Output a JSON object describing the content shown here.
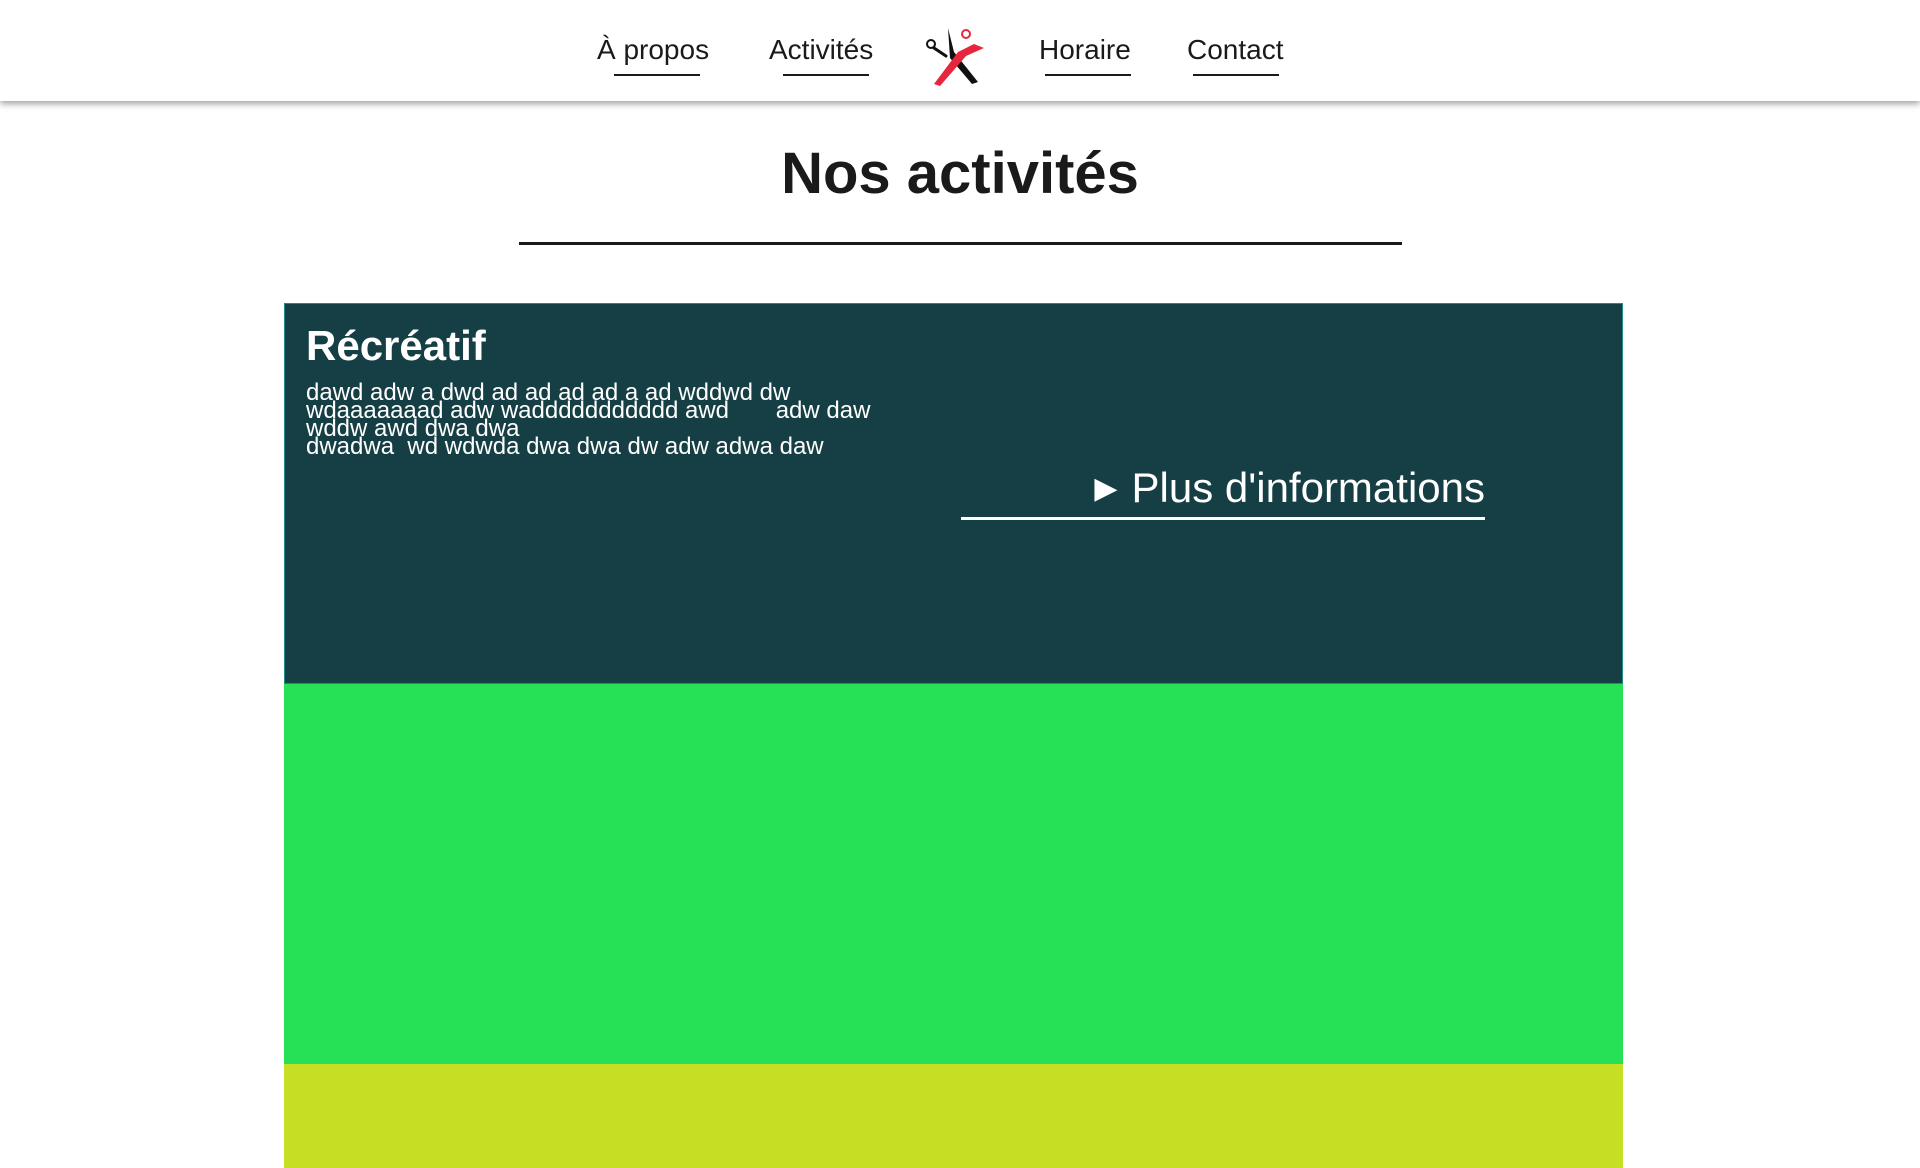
{
  "nav": {
    "links": [
      {
        "label": "À propos"
      },
      {
        "label": "Activités"
      },
      {
        "label": "Horaire"
      },
      {
        "label": "Contact"
      }
    ]
  },
  "page": {
    "title": "Nos activités"
  },
  "cards": [
    {
      "title": "Récréatif",
      "description_lines": [
        "dawd adw a dwd ad ad ad ad a ad wddwd dw",
        "wdaaaaaaad adw waddddddddddd awd       adw daw",
        "wddw awd dwa dwa",
        "dwadwa  wd wdwda dwa dwa dw adw adwa daw"
      ],
      "more_label": "Plus d'informations",
      "more_icon": "play-triangle-icon",
      "color": "#163f45"
    },
    {
      "color": "#26e055"
    },
    {
      "color": "#c6df24"
    }
  ],
  "colors": {
    "text": "#1a1a1a",
    "logo_red": "#e8253f",
    "logo_black": "#111111"
  }
}
